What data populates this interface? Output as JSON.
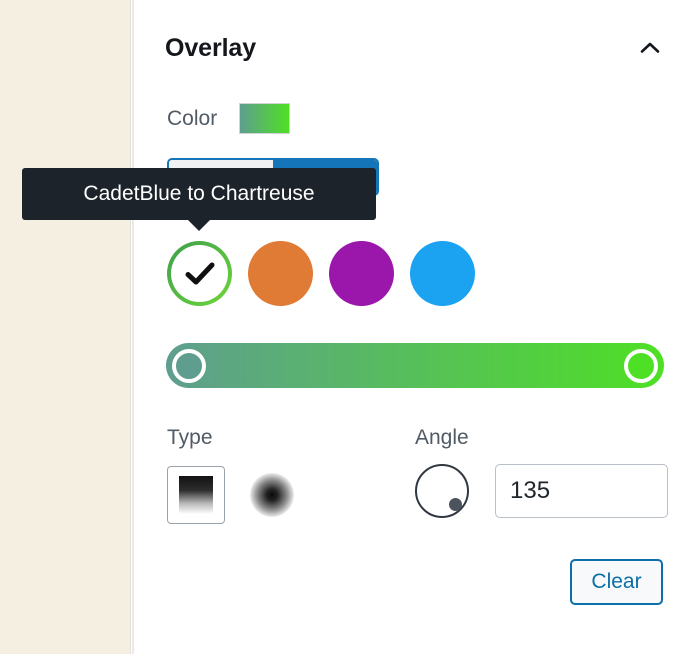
{
  "panel": {
    "title": "Overlay",
    "collapse_icon": "chevron-up-icon"
  },
  "color_field": {
    "label": "Color",
    "swatch_from": "#5f9e8f",
    "swatch_to": "#4ee024"
  },
  "segmented_control": {
    "left_label": "",
    "right_label": "",
    "selected_index": 0,
    "accent": "#1476b8"
  },
  "tooltip": {
    "text": "CadetBlue to Chartreuse",
    "background": "#1d232b"
  },
  "presets": [
    {
      "name": "cadetblue-to-chartreuse",
      "ring_from": "#3f9e4c",
      "ring_to": "#6ed63a",
      "selected": true,
      "check_icon": "check-icon"
    },
    {
      "name": "orange-preset",
      "color": "#e07b36",
      "selected": false
    },
    {
      "name": "purple-preset",
      "color": "#9b17ab",
      "selected": false
    },
    {
      "name": "blue-preset",
      "color": "#1ba3f2",
      "selected": false
    }
  ],
  "gradient_slider": {
    "from": "#5f9e8f",
    "to": "#4ee024",
    "handle_left_pct": 0,
    "handle_right_pct": 100
  },
  "type_field": {
    "label": "Type",
    "options": [
      {
        "name": "linear-gradient-icon",
        "selected": true
      },
      {
        "name": "radial-gradient-icon",
        "selected": false
      }
    ]
  },
  "angle_field": {
    "label": "Angle",
    "value": "135",
    "placeholder": "0",
    "dial_icon": "angle-dial-icon"
  },
  "clear_button": {
    "label": "Clear",
    "color": "#0c6fa8"
  }
}
